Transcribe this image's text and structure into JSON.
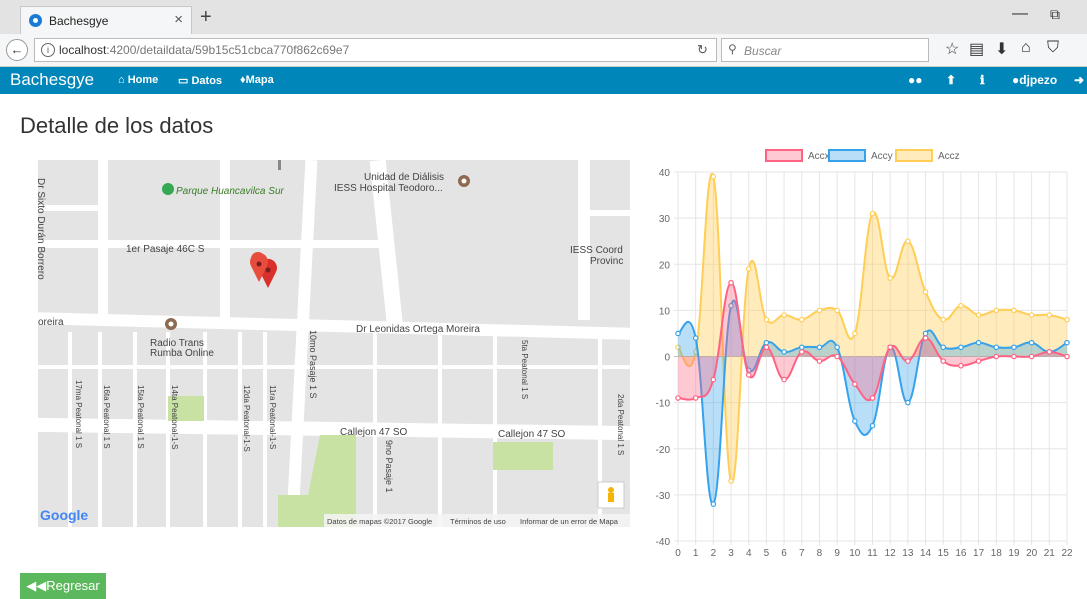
{
  "browser": {
    "tab_title": "Bachesgye",
    "tab_close": "×",
    "new_tab": "+",
    "url_prefix": "localhost",
    "url_rest": ":4200/detaildata/59b15c51cbca770f862c69e7",
    "search_placeholder": "Buscar",
    "minimize": "—",
    "restore": "⧉",
    "icons": [
      "back-icon",
      "info-icon",
      "reload-icon",
      "search-icon",
      "bookmark-star-icon",
      "reading-list-icon",
      "download-icon",
      "home-icon",
      "pocket-icon"
    ]
  },
  "navbar": {
    "brand": "Bachesgye",
    "links": [
      {
        "icon": "home-icon",
        "label": "Home"
      },
      {
        "icon": "laptop-icon",
        "label": "Datos"
      },
      {
        "icon": "map-marker-icon",
        "label": "Mapa"
      }
    ],
    "user": "djpezo",
    "right_icons": [
      "users-icon",
      "upload-icon",
      "info-circle-icon",
      "user-icon",
      "sign-out-icon"
    ],
    "color": "#0086b8"
  },
  "page": {
    "title": "Detalle de los datos",
    "back_button": "Regresar",
    "back_button_color": "#5cb85c"
  },
  "map": {
    "labels": {
      "clinic": "Unidad de Diálisis",
      "clinic2": "IESS Hospital Teodoro...",
      "park": "Parque Huancavilca Sur",
      "pasaje": "1er Pasaje 46C S",
      "iess_right1": "IESS Coord",
      "iess_right2": "Provinc",
      "street_left": "Dr Sixto Durán Borrero",
      "moreira_left": "oreira",
      "ortega": "Dr Leonidas Ortega Moreira",
      "radio1": "Radio Trans",
      "radio2": "Rumba Online",
      "p17": "17ma Peatonal 1 S",
      "p16": "16ta Peatonal 1 S",
      "p15": "15ta Peatonal 1 S",
      "p14": "14ta Peatonal-1-S",
      "p12": "12da Peatonal-1-S",
      "p11": "11ra Peatonal-1-S",
      "p10": "10mo Pasaje 1 S",
      "p9": "9no Pasaje 1",
      "p5": "5ta Peatonal 1 S",
      "p2": "2da Peatonal 1 S",
      "callejon1": "Callejon 47 SO",
      "callejon2": "Callejon 47 SO",
      "google": "Google",
      "footer1": "Datos de mapas ©2017 Google",
      "footer2": "Términos de uso",
      "footer3": "Informar de un error de Mapa"
    }
  },
  "chart_data": {
    "type": "area",
    "x": [
      0,
      1,
      2,
      3,
      4,
      5,
      6,
      7,
      8,
      9,
      10,
      11,
      12,
      13,
      14,
      15,
      16,
      17,
      18,
      19,
      20,
      21,
      22
    ],
    "ylim": [
      -40,
      40
    ],
    "yticks": [
      40,
      30,
      20,
      10,
      0,
      -10,
      -20,
      -30,
      -40
    ],
    "grid": true,
    "legend_position": "top",
    "series": [
      {
        "name": "Accx",
        "color": "#ff6384",
        "fill": "rgba(255,99,132,0.35)",
        "values": [
          -9,
          -9,
          -5,
          16,
          -4,
          2,
          -5,
          1,
          -1,
          0,
          -6,
          -9,
          2,
          -1,
          4,
          -1,
          -2,
          -1,
          0,
          0,
          0,
          1,
          0
        ]
      },
      {
        "name": "Accy",
        "color": "#36a2eb",
        "fill": "rgba(54,162,235,0.35)",
        "values": [
          5,
          4,
          -32,
          11,
          -3,
          3,
          1,
          2,
          2,
          2,
          -14,
          -15,
          2,
          -10,
          5,
          2,
          2,
          3,
          2,
          2,
          3,
          1,
          3
        ]
      },
      {
        "name": "Accz",
        "color": "#ffce56",
        "fill": "rgba(255,206,86,0.4)",
        "values": [
          2,
          1,
          39,
          -27,
          19,
          8,
          9,
          8,
          10,
          10,
          5,
          31,
          17,
          25,
          14,
          8,
          11,
          9,
          10,
          10,
          9,
          9,
          8
        ]
      }
    ]
  }
}
